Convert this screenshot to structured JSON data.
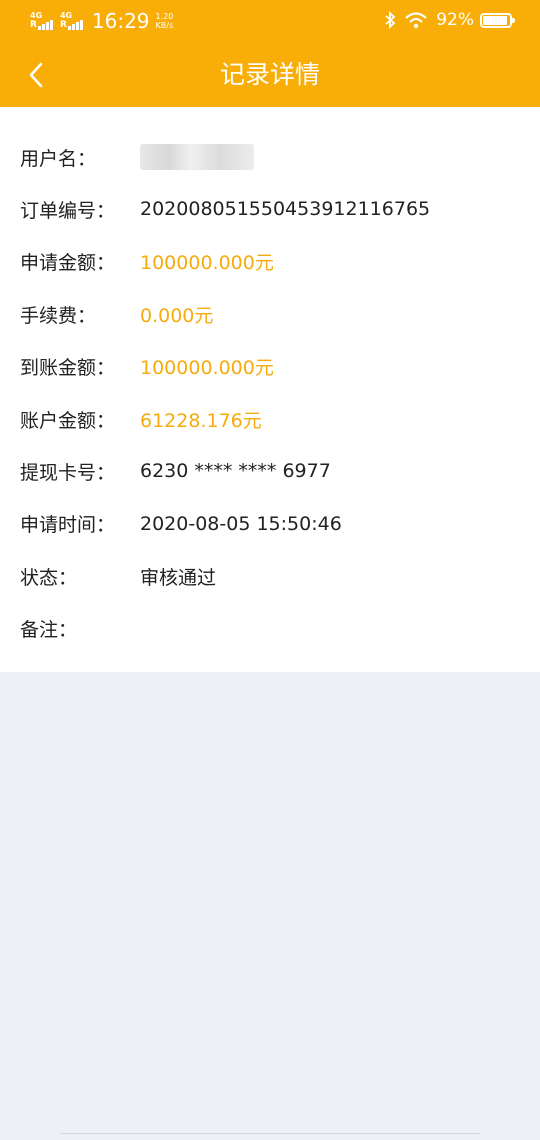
{
  "status_bar": {
    "signal1": "4G",
    "signal2": "4G",
    "time": "16:29",
    "net_speed_value": "1.20",
    "net_speed_unit": "KB/s",
    "battery": "92%",
    "battery_level": 0.92
  },
  "nav": {
    "title": "记录详情"
  },
  "details": [
    {
      "label": "用户名：",
      "value": "",
      "kind": "masked"
    },
    {
      "label": "订单编号：",
      "value": "2020080515504539121167 65",
      "kind": "normal"
    },
    {
      "label": "申请金额：",
      "value": "100000.000元",
      "kind": "amount"
    },
    {
      "label": "手续费：",
      "value": "0.000元",
      "kind": "amount"
    },
    {
      "label": "到账金额：",
      "value": "100000.000元",
      "kind": "amount"
    },
    {
      "label": "账户金额：",
      "value": "61228.176元",
      "kind": "amount"
    },
    {
      "label": "提现卡号：",
      "value": "6230 **** **** 6977",
      "kind": "normal"
    },
    {
      "label": "申请时间：",
      "value": "2020-08-05 15:50:46",
      "kind": "normal"
    },
    {
      "label": "状态：",
      "value": "审核通过",
      "kind": "normal"
    },
    {
      "label": "备注：",
      "value": "",
      "kind": "normal"
    }
  ],
  "colors": {
    "header": "#f8ae06",
    "amount": "#f5ac0c",
    "background": "#eef0f5"
  }
}
